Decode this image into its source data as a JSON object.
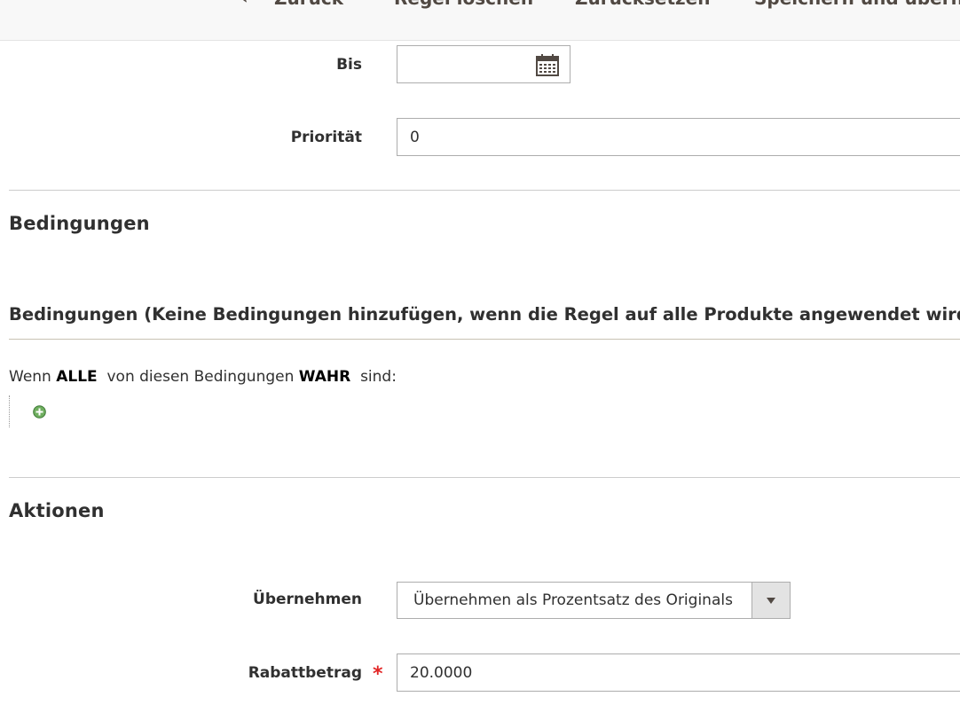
{
  "toolbar": {
    "back_label": "Zurück",
    "delete_label": "Regel löschen",
    "reset_label": "Zurücksetzen",
    "save_apply_label": "Speichern und übernehmen"
  },
  "form": {
    "to_label": "Bis",
    "to_value": "",
    "priority_label": "Priorität",
    "priority_value": "0"
  },
  "conditions": {
    "section_title": "Bedingungen",
    "fieldset_title": "Bedingungen (Keine Bedingungen hinzufügen, wenn die Regel auf alle Produkte angewendet wird)",
    "sentence_prefix": "Wenn",
    "aggregator": "ALLE",
    "sentence_middle": "von diesen Bedingungen",
    "value": "WAHR",
    "sentence_suffix": "sind:"
  },
  "actions": {
    "section_title": "Aktionen",
    "apply_label": "Übernehmen",
    "apply_value": "Übernehmen als Prozentsatz des Originals",
    "discount_label": "Rabattbetrag",
    "discount_required": "*",
    "discount_value": "20.0000"
  },
  "icons": {
    "calendar": "calendar-icon",
    "add": "add-condition-icon",
    "back": "chevron-left-icon",
    "dropdown": "chevron-down-icon"
  },
  "colors": {
    "required": "#e22626",
    "add_icon": "#5d9b4f"
  }
}
